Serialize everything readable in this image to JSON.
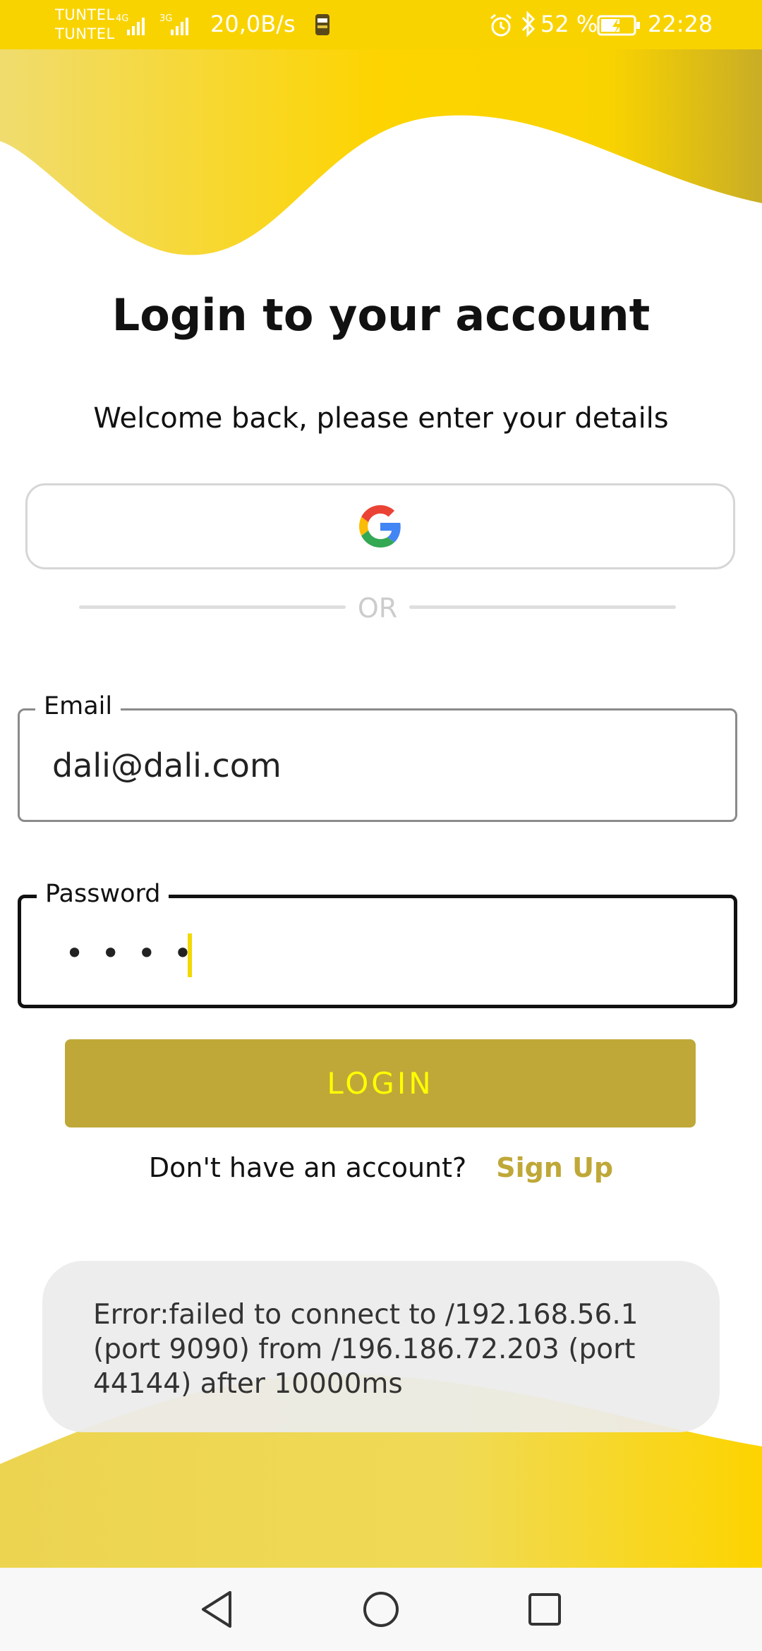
{
  "status_bar": {
    "carrier_1": "TUNTEL",
    "carrier_2": "TUNTEL",
    "network_1": "4G",
    "network_2": "3G",
    "net_speed": "20,0B/s",
    "battery_percent": "52 %",
    "time": "22:28",
    "icons": [
      "signal-icon",
      "app-notification-icon",
      "alarm-icon",
      "bluetooth-icon",
      "battery-charging-icon"
    ]
  },
  "login": {
    "title": "Login to your account",
    "subtitle": "Welcome back, please enter your details",
    "google_icon": "google-icon",
    "divider_text": "OR",
    "email": {
      "label": "Email",
      "value": "dali@dali.com"
    },
    "password": {
      "label": "Password",
      "masked_value": "••••"
    },
    "login_button": "LOGIN",
    "signup_prompt": "Don't have an account?",
    "signup_link": "Sign Up"
  },
  "error_toast": {
    "message": "Error:failed to connect to /192.168.56.1 (port 9090) from /196.186.72.203 (port 44144) after 10000ms"
  },
  "nav_bar": {
    "icons": [
      "back-icon",
      "home-icon",
      "recents-icon"
    ]
  },
  "colors": {
    "accent_yellow": "#f9d300",
    "login_button_bg": "#bfa838",
    "login_button_text": "#ffff00",
    "link": "#bfa838"
  }
}
